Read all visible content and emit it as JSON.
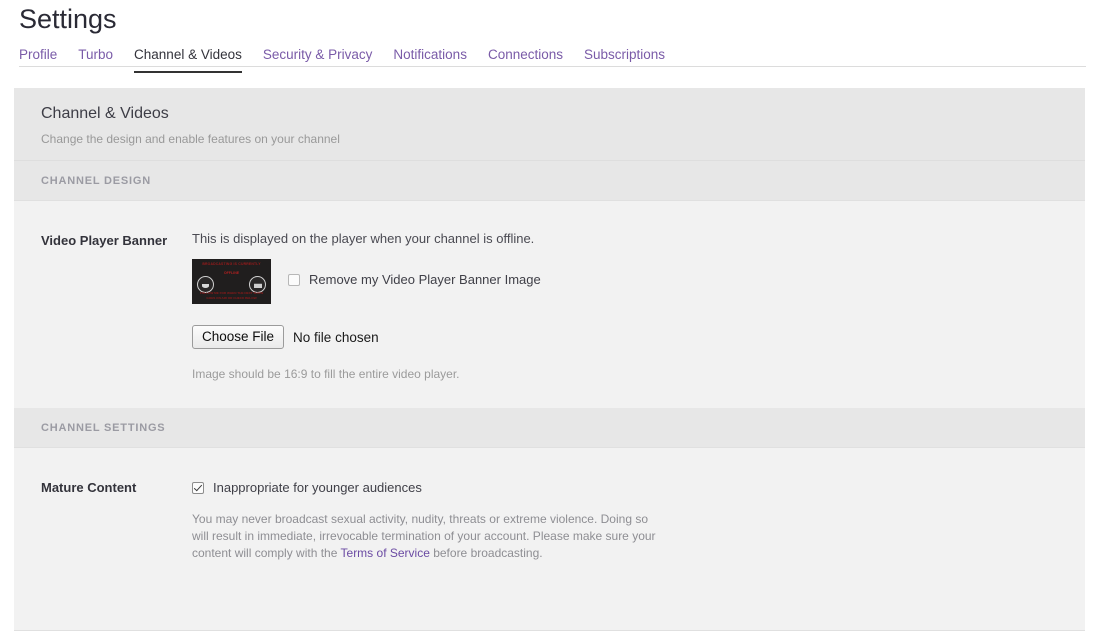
{
  "page": {
    "title": "Settings"
  },
  "tabs": [
    {
      "label": "Profile",
      "active": false
    },
    {
      "label": "Turbo",
      "active": false
    },
    {
      "label": "Channel & Videos",
      "active": true
    },
    {
      "label": "Security & Privacy",
      "active": false
    },
    {
      "label": "Notifications",
      "active": false
    },
    {
      "label": "Connections",
      "active": false
    },
    {
      "label": "Subscriptions",
      "active": false
    }
  ],
  "panel": {
    "heading": "Channel & Videos",
    "subheading": "Change the design and enable features on your channel"
  },
  "channel_design": {
    "band_label": "CHANNEL DESIGN",
    "video_player_banner": {
      "label": "Video Player Banner",
      "description": "This is displayed on the player when your channel is offline.",
      "thumbnail": {
        "title_text": "BROADCASTING IS CURRENTLY",
        "sub_text": "OFFLINE",
        "footer_line1": "FOLLOW ME FOR WHEN THE NEXT SHOW",
        "footer_line2": "GOES ON AIR OR CHECK BELOW",
        "background_color": "#201e1e",
        "text_color": "#9e1b1b"
      },
      "remove_checkbox": {
        "label": "Remove my Video Player Banner Image",
        "checked": false
      },
      "file_input": {
        "button_label": "Choose File",
        "status_text": "No file chosen"
      },
      "hint": "Image should be 16:9 to fill the entire video player."
    }
  },
  "channel_settings": {
    "band_label": "CHANNEL SETTINGS",
    "mature_content": {
      "label": "Mature Content",
      "checkbox": {
        "label": "Inappropriate for younger audiences",
        "checked": true
      },
      "note_part1": "You may never broadcast sexual activity, nudity, threats or extreme violence. Doing so will result in immediate, irrevocable termination of your account. Please make sure your content will comply with the ",
      "note_link": "Terms of Service",
      "note_part2": " before broadcasting."
    }
  },
  "colors": {
    "accent_purple": "#7a5ba8",
    "link_purple": "#6b4ba3",
    "panel_header_bg": "#e7e7e7",
    "panel_body_bg": "#f2f2f2",
    "active_tab_underline": "#333333"
  }
}
